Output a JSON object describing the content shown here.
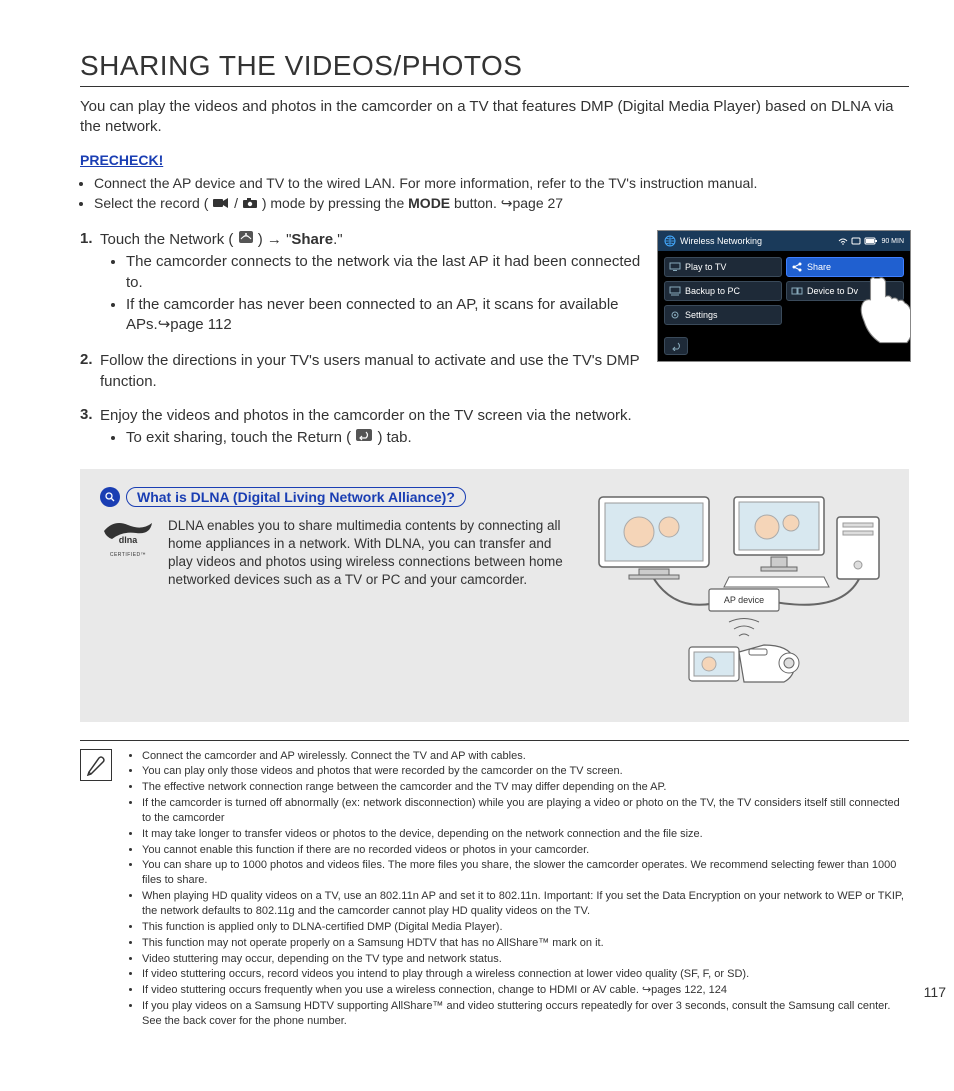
{
  "title": "SHARING THE VIDEOS/PHOTOS",
  "intro": "You can play the videos and photos in the camcorder on a TV that features DMP (Digital Media Player) based on DLNA via the network.",
  "precheck_label": "PRECHECK!",
  "precheck": {
    "item1": "Connect the AP device and TV to the wired LAN. For more information, refer to the TV's instruction manual.",
    "item2_a": "Select the record (",
    "item2_b": ") mode by pressing the ",
    "item2_mode": "MODE",
    "item2_c": " button. ",
    "item2_ref": "page 27"
  },
  "screen": {
    "header": "Wireless Networking",
    "time": "90 MIN",
    "items": {
      "play": "Play to TV",
      "share": "Share",
      "backup": "Backup to PC",
      "device": "Device to Dv",
      "settings": "Settings"
    }
  },
  "steps": {
    "s1": {
      "num": "1.",
      "line_a": "Touch the Network (",
      "line_b": ") → \"",
      "share": "Share",
      "line_c": ".\"",
      "b1": "The camcorder connects to the network via the last AP it had been connected to.",
      "b2_a": "If the camcorder has never been connected to an AP, it scans for available APs.",
      "b2_ref": "page 112"
    },
    "s2": {
      "num": "2.",
      "text": "Follow the directions in your TV's users manual to activate and use the TV's DMP function."
    },
    "s3": {
      "num": "3.",
      "text": "Enjoy the videos and photos in the camcorder on the TV screen via the network.",
      "b1_a": "To exit sharing, touch the Return (",
      "b1_b": ") tab."
    }
  },
  "dlna": {
    "callout": "What is DLNA (Digital Living Network Alliance)?",
    "logo_sub": "CERTIFIED™",
    "text": "DLNA enables you to share multimedia contents by connecting all home appliances in a network. With DLNA, you can transfer and play videos and photos using wireless connections between home networked devices such as a TV or PC and your camcorder.",
    "ap_label": "AP device"
  },
  "notes": [
    "Connect the camcorder and AP wirelessly. Connect the TV and AP with cables.",
    "You can play only those videos and photos that were recorded by the camcorder on the TV screen.",
    "The effective network connection range between the camcorder and the TV may differ depending on the AP.",
    "If the camcorder is turned off abnormally (ex: network disconnection) while you are playing a video or photo on the TV, the TV considers itself still connected to the camcorder",
    "It may take longer to transfer videos or photos to the device, depending on the network connection and the file size.",
    "You cannot enable this function if there are no recorded videos or photos in your camcorder.",
    "You can share up to 1000 photos and videos files. The more files you share, the slower the camcorder operates. We recommend selecting fewer than 1000 files to share.",
    "When playing HD quality videos on a TV, use an 802.11n AP and set it to 802.11n. Important: If you set the Data Encryption on your network to WEP or TKIP, the network defaults to 802.11g and the camcorder cannot play HD quality videos on the TV.",
    "This function is applied only to DLNA-certified DMP (Digital Media Player).",
    "This function may not operate properly on a Samsung HDTV that has no AllShare™ mark on it.",
    "Video stuttering may occur, depending on the TV type and network status.",
    "If video stuttering occurs, record videos you intend to play through a wireless connection at lower video quality (SF, F, or SD).",
    "If video stuttering occurs frequently when you use a wireless connection, change to HDMI or AV cable. ↪pages 122, 124",
    "If you play videos on a Samsung HDTV supporting AllShare™ and video stuttering occurs repeatedly for over 3 seconds, consult the Samsung call center. See the back cover for the phone number."
  ],
  "page_number": "117"
}
